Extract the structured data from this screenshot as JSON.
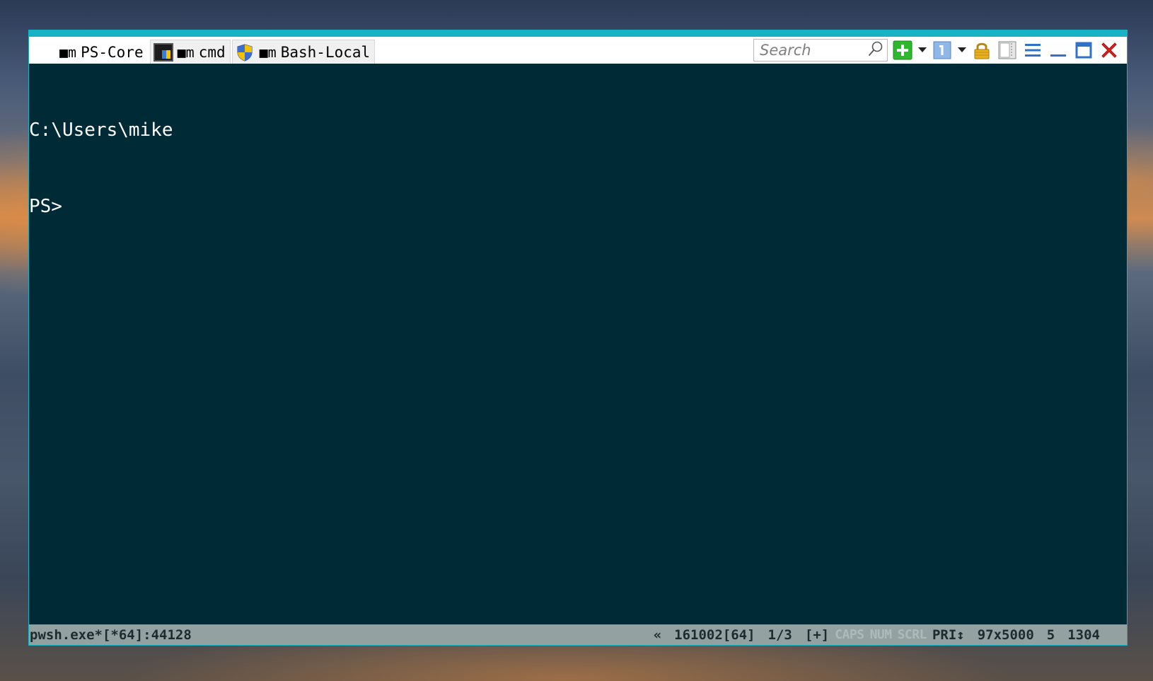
{
  "tabs": [
    {
      "label": "PS-Core",
      "icon": "powershell-icon",
      "glyph": "■m",
      "active": true
    },
    {
      "label": "cmd",
      "icon": "cmd-console-icon",
      "glyph": "■m",
      "active": false
    },
    {
      "label": "Bash-Local",
      "icon": "shield-icon",
      "glyph": "■m",
      "active": false
    }
  ],
  "toolbar": {
    "search_placeholder": "Search",
    "buttons": [
      "new-console-icon",
      "console-info-icon",
      "lock-icon",
      "split-pane-icon",
      "menu-icon",
      "minimize-icon",
      "maximize-icon",
      "close-icon"
    ]
  },
  "terminal": {
    "lines": [
      "C:\\Users\\mike",
      "PS>"
    ]
  },
  "status": {
    "process": "pwsh.exe*[*64]:44128",
    "scroll": "«",
    "pid": "161002[64]",
    "console_index": "1/3",
    "plus": "[+]",
    "caps": "CAPS",
    "num": "NUM",
    "scrl": "SCRL",
    "pri": "PRI↕",
    "size": "97x5000",
    "col": "5",
    "num2": "1304"
  },
  "colors": {
    "accent": "#17b3c4",
    "terminal_bg": "#002b36",
    "statusbar_bg": "#93a1a1",
    "new_button": "#2eb82e",
    "close": "#e02020"
  }
}
